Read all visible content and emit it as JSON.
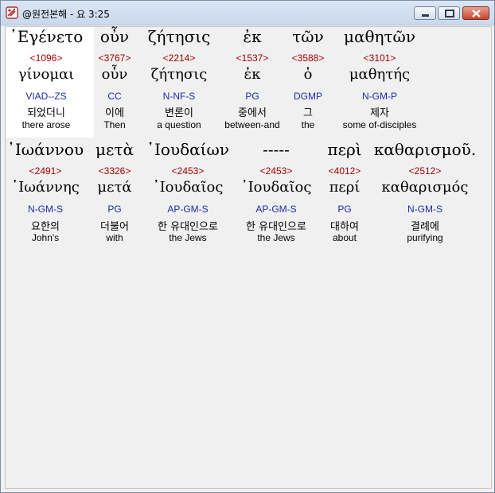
{
  "window": {
    "title": "@원전본해 - 요 3:25",
    "controls": {
      "minimize": "minimize",
      "maximize": "maximize",
      "close": "close"
    }
  },
  "rows": [
    {
      "words": [
        {
          "greek": "᾿Εγένετο",
          "strong": "<1096>",
          "lemma": "γίνομαι",
          "parsing": "VIAD--ZS",
          "korean": "되었더니",
          "english": "there arose"
        },
        {
          "greek": "οὖν",
          "strong": "<3767>",
          "lemma": "οὖν",
          "parsing": "CC",
          "korean": "이에",
          "english": "Then"
        },
        {
          "greek": "ζήτησις",
          "strong": "<2214>",
          "lemma": "ζήτησις",
          "parsing": "N-NF-S",
          "korean": "변론이",
          "english": "a question"
        },
        {
          "greek": "ἐκ",
          "strong": "<1537>",
          "lemma": "ἐκ",
          "parsing": "PG",
          "korean": "중에서",
          "english": "between-and"
        },
        {
          "greek": "τῶν",
          "strong": "<3588>",
          "lemma": "ὁ",
          "parsing": "DGMP",
          "korean": "그",
          "english": "the"
        },
        {
          "greek": "μαθητῶν",
          "strong": "<3101>",
          "lemma": "μαθητής",
          "parsing": "N-GM-P",
          "korean": "제자",
          "english": "some of-disciples"
        }
      ]
    },
    {
      "words": [
        {
          "greek": "᾿Ιωάννου",
          "strong": "<2491>",
          "lemma": "᾿Ιωάννης",
          "parsing": "N-GM-S",
          "korean": "요한의",
          "english": "John's"
        },
        {
          "greek": "μετὰ",
          "strong": "<3326>",
          "lemma": "μετά",
          "parsing": "PG",
          "korean": "더불어",
          "english": "with"
        },
        {
          "greek": "᾿Ιουδαίων",
          "strong": "<2453>",
          "lemma": "᾿Ιουδαῖος",
          "parsing": "AP-GM-S",
          "korean": "한 유대인으로",
          "english": "the Jews"
        },
        {
          "greek": "-----",
          "strong": "<2453>",
          "lemma": "᾿Ιουδαῖος",
          "parsing": "AP-GM-S",
          "korean": "한 유대인으로",
          "english": "the Jews"
        },
        {
          "greek": "περὶ",
          "strong": "<4012>",
          "lemma": "περί",
          "parsing": "PG",
          "korean": "대하여",
          "english": "about"
        },
        {
          "greek": "καθαρισμοῦ.",
          "strong": "<2512>",
          "lemma": "καθαρισμός",
          "parsing": "N-GM-S",
          "korean": "결례에",
          "english": "purifying"
        }
      ]
    }
  ],
  "colors": {
    "strong_number": "#a00000",
    "parsing": "#1a2da8",
    "highlight": "#ffffff",
    "background": "#f0f0f0"
  }
}
